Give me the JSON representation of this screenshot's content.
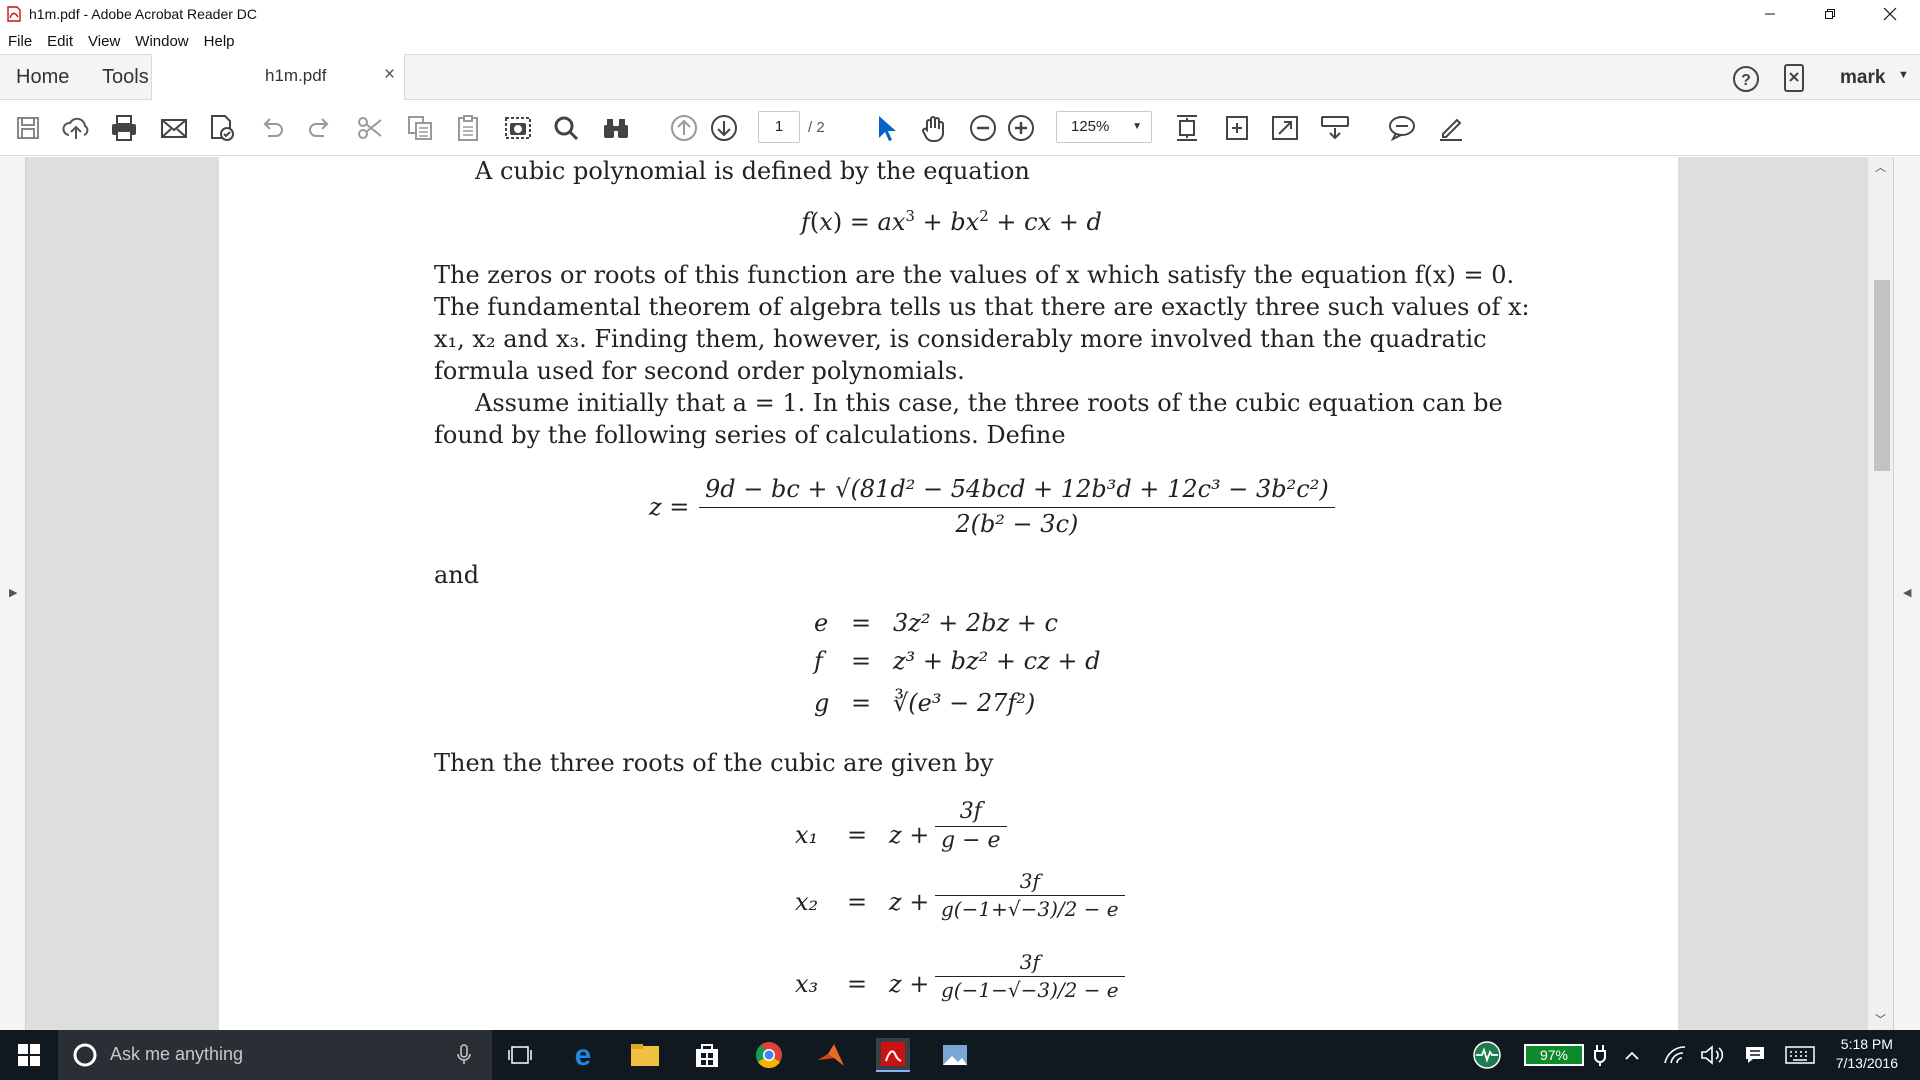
{
  "window": {
    "title": "h1m.pdf - Adobe Acrobat Reader DC"
  },
  "menu": [
    "File",
    "Edit",
    "View",
    "Window",
    "Help"
  ],
  "tabs": {
    "home": "Home",
    "tools": "Tools",
    "document": "h1m.pdf",
    "close": "×"
  },
  "account": {
    "user": "mark"
  },
  "toolbar": {
    "page_current": "1",
    "page_total": "/ 2",
    "zoom": "125%"
  },
  "document": {
    "line1": "A cubic polynomial is defined by the equation",
    "eq1": "f(x) = ax³ + bx² + cx + d",
    "p1": [
      "The zeros or roots of this function are the values of x which satisfy the equation f(x) = 0.",
      "The fundamental theorem of algebra tells us that there are exactly three such values of x:",
      "x₁, x₂ and x₃. Finding them, however, is considerably more involved than the quadratic",
      "formula used for second order polynomials."
    ],
    "p2": [
      "Assume initially that a = 1. In this case, the three roots of the cubic equation can be",
      "found by the following series of calculations. Define"
    ],
    "z_lhs": "z =",
    "z_num": "9d − bc + √(81d² − 54bcd + 12b³d + 12c³ − 3b²c²)",
    "z_den": "2(b² − 3c)",
    "and": "and",
    "defs": [
      {
        "lhs": "e",
        "rhs": "3z² + 2bz + c"
      },
      {
        "lhs": "f",
        "rhs": "z³ + bz² + cz + d"
      },
      {
        "lhs": "g",
        "rhs": "∛(e³ − 27f²)"
      }
    ],
    "then": "Then the three roots of the cubic are given by",
    "roots": [
      {
        "lhs": "x₁",
        "num": "3f",
        "den": "g − e"
      },
      {
        "lhs": "x₂",
        "num": "3f",
        "den": "g(−1+√−3)/2 − e"
      },
      {
        "lhs": "x₃",
        "num": "3f",
        "den": "g(−1−√−3)/2 − e"
      }
    ],
    "equals": "=",
    "z_plus": "z +"
  },
  "taskbar": {
    "search_placeholder": "Ask me anything",
    "battery": "97%",
    "time": "5:18 PM",
    "date": "7/13/2016"
  },
  "colors": {
    "taskbar": "#101820",
    "workspace": "#dedede",
    "accent": "#0a64c8",
    "acrobat_red": "#cc1111"
  }
}
